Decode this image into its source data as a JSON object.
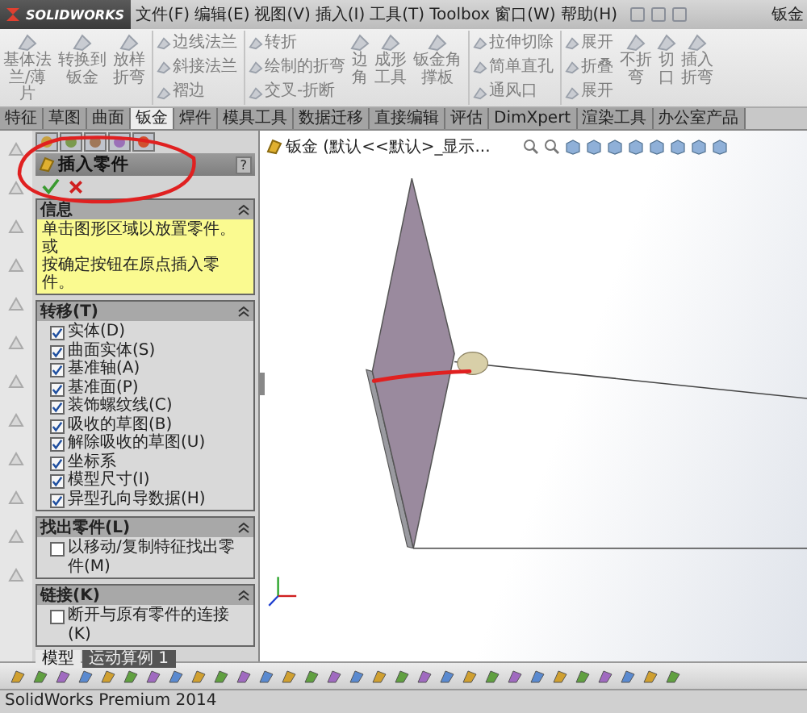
{
  "app": {
    "logo": "SOLIDWORKS",
    "document_title": "钣金"
  },
  "menus": [
    "文件(F)",
    "编辑(E)",
    "视图(V)",
    "插入(I)",
    "工具(T)",
    "Toolbox",
    "窗口(W)",
    "帮助(H)"
  ],
  "ribbon": {
    "disabled": true,
    "items": [
      {
        "kind": "large",
        "label": "基体法兰/薄片"
      },
      {
        "kind": "large",
        "label": "转换到钣金"
      },
      {
        "kind": "large",
        "label": "放样折弯"
      },
      {
        "kind": "stack",
        "items": [
          "边线法兰",
          "斜接法兰",
          "褶边"
        ]
      },
      {
        "kind": "stack",
        "items": [
          "转折",
          "绘制的折弯",
          "交叉-折断"
        ]
      },
      {
        "kind": "large",
        "label": "边角"
      },
      {
        "kind": "large",
        "label": "成形工具"
      },
      {
        "kind": "large",
        "label": "钣金角撑板"
      },
      {
        "kind": "stack",
        "items": [
          "拉伸切除",
          "简单直孔",
          "通风口"
        ]
      },
      {
        "kind": "stack",
        "items": [
          "展开",
          "折叠",
          "展开"
        ]
      },
      {
        "kind": "large",
        "label": "不折弯"
      },
      {
        "kind": "large",
        "label": "切口"
      },
      {
        "kind": "large",
        "label": "插入折弯"
      }
    ]
  },
  "command_tabs": [
    {
      "label": "特征",
      "selected": false
    },
    {
      "label": "草图",
      "selected": false
    },
    {
      "label": "曲面",
      "selected": false
    },
    {
      "label": "钣金",
      "selected": true
    },
    {
      "label": "焊件",
      "selected": false
    },
    {
      "label": "模具工具",
      "selected": false
    },
    {
      "label": "数据迁移",
      "selected": false
    },
    {
      "label": "直接编辑",
      "selected": false
    },
    {
      "label": "评估",
      "selected": false
    },
    {
      "label": "DimXpert",
      "selected": false
    },
    {
      "label": "渲染工具",
      "selected": false
    },
    {
      "label": "办公室产品",
      "selected": false
    }
  ],
  "property_manager": {
    "title": "插入零件",
    "help": "?",
    "sections": [
      {
        "kind": "message",
        "title": "信息",
        "lines": [
          "单击图形区域以放置零件。",
          "或",
          "按确定按钮在原点插入零件。"
        ]
      },
      {
        "kind": "checklist",
        "title": "转移(T)",
        "items": [
          {
            "label": "实体(D)",
            "checked": true
          },
          {
            "label": "曲面实体(S)",
            "checked": true
          },
          {
            "label": "基准轴(A)",
            "checked": true
          },
          {
            "label": "基准面(P)",
            "checked": true
          },
          {
            "label": "装饰螺纹线(C)",
            "checked": true
          },
          {
            "label": "吸收的草图(B)",
            "checked": true
          },
          {
            "label": "解除吸收的草图(U)",
            "checked": true
          },
          {
            "label": "坐标系",
            "checked": true
          },
          {
            "label": "模型尺寸(I)",
            "checked": true
          },
          {
            "label": "异型孔向导数据(H)",
            "checked": true
          }
        ]
      },
      {
        "kind": "checklist",
        "title": "找出零件(L)",
        "items": [
          {
            "label": "以移动/复制特征找出零件(M)",
            "checked": false
          }
        ]
      },
      {
        "kind": "checklist",
        "title": "链接(K)",
        "items": [
          {
            "label": "断开与原有零件的连接(K)",
            "checked": false
          }
        ]
      }
    ]
  },
  "tree_header": "钣金 (默认<<默认>_显示...",
  "bottom_tabs": [
    {
      "label": "模型",
      "selected": true
    },
    {
      "label": "运动算例 1",
      "selected": false
    }
  ],
  "status_bar": "SolidWorks Premium 2014"
}
